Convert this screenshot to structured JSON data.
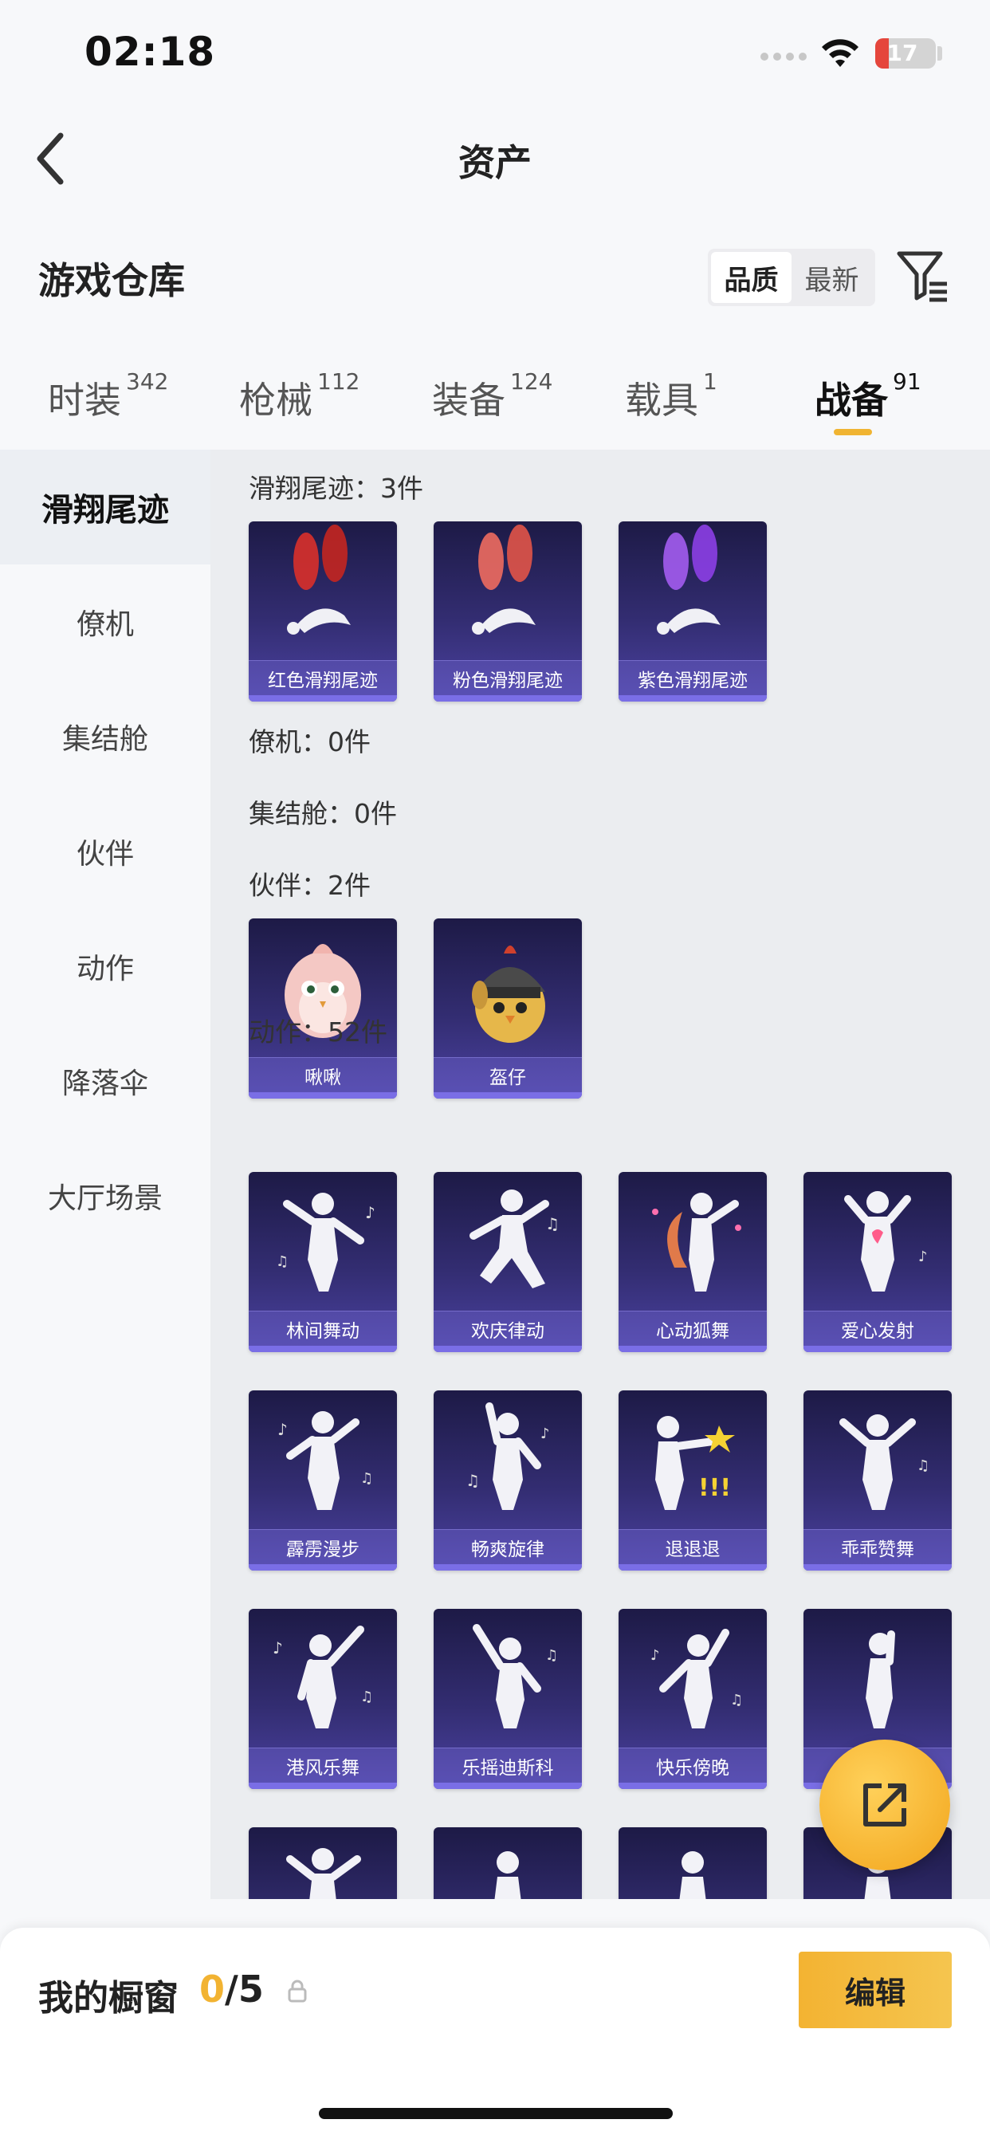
{
  "status_bar": {
    "time": "02:18",
    "battery": "17"
  },
  "nav": {
    "title": "资产"
  },
  "warehouse": {
    "title": "游戏仓库",
    "sort_options": [
      "品质",
      "最新"
    ],
    "sort_selected": "品质"
  },
  "category_tabs": [
    {
      "label": "时装",
      "count": "342"
    },
    {
      "label": "枪械",
      "count": "112"
    },
    {
      "label": "装备",
      "count": "124"
    },
    {
      "label": "载具",
      "count": "1"
    },
    {
      "label": "战备",
      "count": "91"
    }
  ],
  "active_category": "战备",
  "sidebar": [
    "滑翔尾迹",
    "僚机",
    "集结舱",
    "伙伴",
    "动作",
    "降落伞",
    "大厅场景"
  ],
  "sections": {
    "glide": {
      "title": "滑翔尾迹：3件",
      "items": [
        "红色滑翔尾迹",
        "粉色滑翔尾迹",
        "紫色滑翔尾迹"
      ]
    },
    "wingman": {
      "title": "僚机：0件"
    },
    "pod": {
      "title": "集结舱：0件"
    },
    "partner": {
      "title": "伙伴：2件",
      "items": [
        "啾啾",
        "盔仔"
      ]
    },
    "emote": {
      "title": "动作：52件",
      "items": [
        "林间舞动",
        "欢庆律动",
        "心动狐舞",
        "爱心发射",
        "霹雳漫步",
        "畅爽旋律",
        "退退退",
        "乖乖赞舞",
        "港风乐舞",
        "乐摇迪斯科",
        "快乐傍晚",
        ""
      ]
    }
  },
  "bottom": {
    "window_label": "我的橱窗",
    "window_current": "0",
    "window_total": "/5",
    "edit_label": "编辑"
  },
  "colors": {
    "accent": "#f2b332",
    "card_bg": "#2f2a6a"
  },
  "icons": [
    "back-icon",
    "filter-icon",
    "share-icon",
    "lock-icon",
    "wifi-icon"
  ]
}
